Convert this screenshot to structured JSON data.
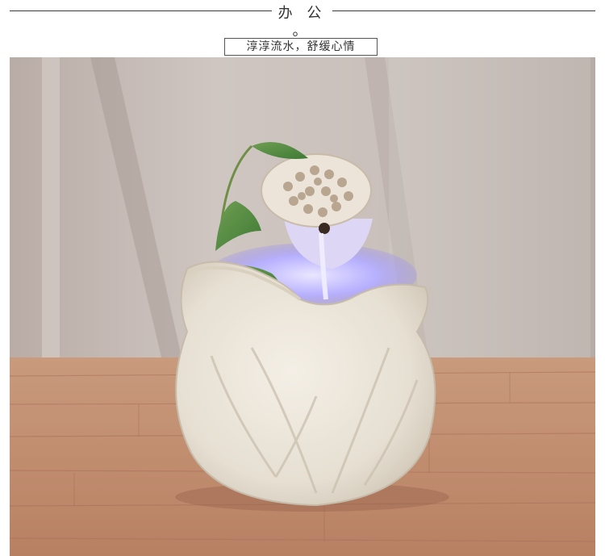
{
  "header": {
    "title": "办 公 。",
    "subtitle": "淳淳流水，舒缓心情"
  },
  "photo": {
    "subject": "ceramic-lotus-tabletop-fountain"
  }
}
